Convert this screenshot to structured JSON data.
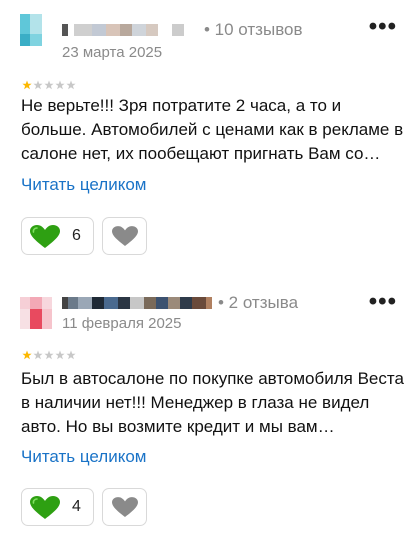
{
  "reviews": [
    {
      "review_count": "• 10 отзывов",
      "date": "23 марта 2025",
      "rating": 1,
      "text": "Не верьте!!! Зря потратите 2 часа, а то и больше. Автомобилей с ценами как в рекламе в салоне нет, их пообещают пригнать Вам со…",
      "read_more": "Читать целиком",
      "likes": "6"
    },
    {
      "review_count": "• 2 отзыва",
      "date": "11 февраля 2025",
      "rating": 1,
      "text": "Был в автосалоне по покупке автомобиля Веста в наличии нет!!! Менеджер в глаза не видел авто. Но вы возмите кредит и мы вам…",
      "read_more": "Читать целиком",
      "likes": "4"
    }
  ],
  "menu_label": "•••",
  "colors": {
    "link": "#1a73c7",
    "star_filled": "#fcb800",
    "star_empty": "#c8c8c8",
    "like_heart": "#2ea012",
    "dislike_heart": "#8a8a8a",
    "meta_text": "#8a8a8a"
  },
  "icons": {
    "like": "green-heart-icon",
    "dislike": "gray-heart-icon",
    "menu": "more-horizontal-icon",
    "star": "star-icon"
  }
}
